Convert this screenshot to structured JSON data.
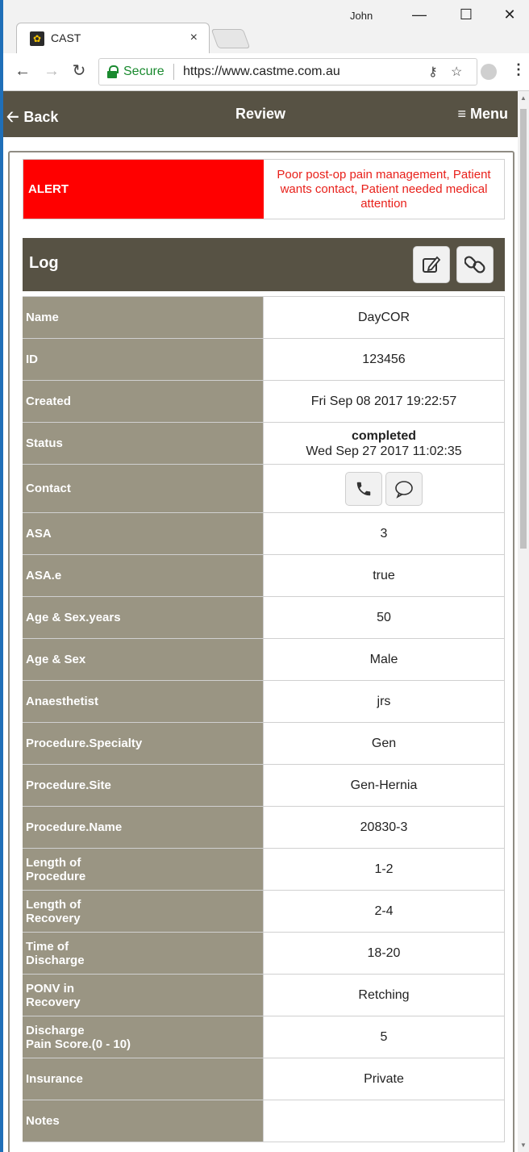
{
  "browser": {
    "user_name": "John",
    "tab_title": "CAST",
    "tab_close": "×",
    "win_minimize": "—",
    "win_maximize": "☐",
    "win_close": "✕",
    "secure_label": "Secure",
    "url": "https://www.castme.com.au",
    "accent_secure": "#1a8a2f"
  },
  "header": {
    "back_label": "Back",
    "title": "Review",
    "menu_label": "Menu",
    "background": "#575244"
  },
  "alert": {
    "label": "ALERT",
    "message": "Poor post-op pain management, Patient wants contact, Patient needed medical attention",
    "label_color": "#ff0000",
    "text_color": "#e8201a"
  },
  "log": {
    "title": "Log",
    "edit_icon": "edit-icon",
    "link_icon": "link-icon"
  },
  "fields": {
    "name": {
      "label": "Name",
      "value": "DayCOR"
    },
    "id": {
      "label": "ID",
      "value": "123456"
    },
    "created": {
      "label": "Created",
      "value": "Fri Sep 08 2017 19:22:57"
    },
    "status": {
      "label": "Status",
      "value": "completed",
      "date": "Wed Sep 27 2017 11:02:35"
    },
    "contact": {
      "label": "Contact",
      "phone_icon": "phone-icon",
      "chat_icon": "chat-bubble-icon"
    },
    "asa": {
      "label": "ASA",
      "value": "3"
    },
    "asa_e": {
      "label": "ASA.e",
      "value": "true"
    },
    "age_sex_years": {
      "label": "Age & Sex.years",
      "value": "50"
    },
    "age_sex": {
      "label": "Age & Sex",
      "value": "Male"
    },
    "anaesthetist": {
      "label": "Anaesthetist",
      "value": "jrs"
    },
    "procedure_specialty": {
      "label": "Procedure.Specialty",
      "value": "Gen"
    },
    "procedure_site": {
      "label": "Procedure.Site",
      "value": "Gen-Hernia"
    },
    "procedure_name": {
      "label": "Procedure.Name",
      "value": "20830-3"
    },
    "length_procedure": {
      "label_l1": "Length of",
      "label_l2": "Procedure",
      "value": "1-2"
    },
    "length_recovery": {
      "label_l1": "Length of",
      "label_l2": "Recovery",
      "value": "2-4"
    },
    "time_discharge": {
      "label_l1": "Time of",
      "label_l2": "Discharge",
      "value": "18-20"
    },
    "ponv_recovery": {
      "label_l1": "PONV in",
      "label_l2": "Recovery",
      "value": "Retching"
    },
    "discharge_pain": {
      "label_l1": "Discharge",
      "label_l2": "Pain Score.(0 - 10)",
      "value": "5"
    },
    "insurance": {
      "label": "Insurance",
      "value": "Private"
    },
    "notes": {
      "label": "Notes",
      "value": ""
    }
  }
}
